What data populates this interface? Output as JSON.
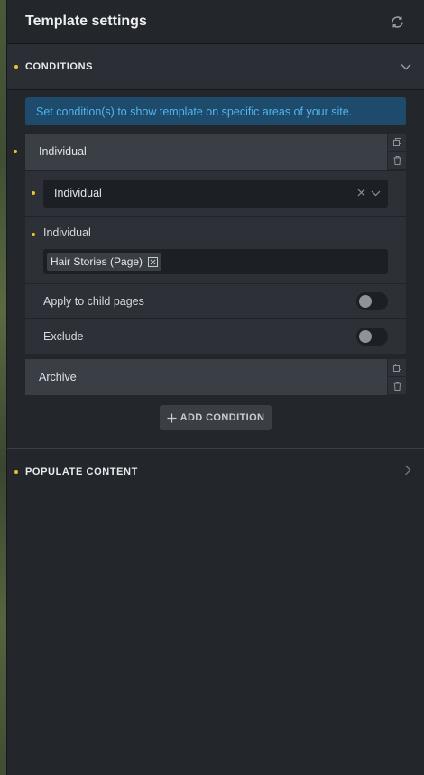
{
  "header": {
    "title": "Template settings",
    "refresh_icon": "refresh-icon"
  },
  "conditions": {
    "title": "CONDITIONS",
    "info": "Set condition(s) to show template on specific areas of your site.",
    "items": [
      {
        "label": "Individual",
        "select_value": "Individual",
        "field_label": "Individual",
        "tags": [
          "Hair Stories (Page)"
        ],
        "toggles": [
          {
            "label": "Apply to child pages",
            "on": false
          },
          {
            "label": "Exclude",
            "on": false
          }
        ]
      },
      {
        "label": "Archive"
      }
    ],
    "add_button": "ADD CONDITION"
  },
  "populate": {
    "title": "POPULATE CONTENT"
  },
  "colors": {
    "accent_dot": "#f0c22b",
    "info_bg": "#1e4b6b",
    "info_text": "#4fb5f0",
    "panel_bg": "#23262b"
  }
}
